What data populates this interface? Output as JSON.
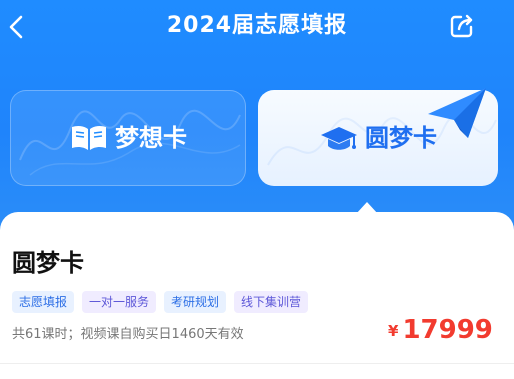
{
  "header": {
    "title": "2024届志愿填报",
    "back_icon": "chevron-left-icon",
    "share_icon": "share-icon"
  },
  "cards": {
    "dream": {
      "label": "梦想卡",
      "icon": "book-icon",
      "selected": false
    },
    "fulfill": {
      "label": "圆梦卡",
      "icon": "graduation-cap-icon",
      "selected": true
    },
    "decor_icon": "paper-plane-icon"
  },
  "plan": {
    "title": "圆梦卡",
    "tags": [
      "志愿填报",
      "一对一服务",
      "考研规划",
      "线下集训营"
    ],
    "meta": "共61课时；视频课自购买日1460天有效",
    "price_symbol": "¥",
    "price": "17999"
  },
  "colors": {
    "brand_blue": "#1f8cff",
    "price_red": "#f23b2f",
    "tag_blue_text": "#2d6fe6",
    "tag_purple_text": "#5d57d8"
  }
}
